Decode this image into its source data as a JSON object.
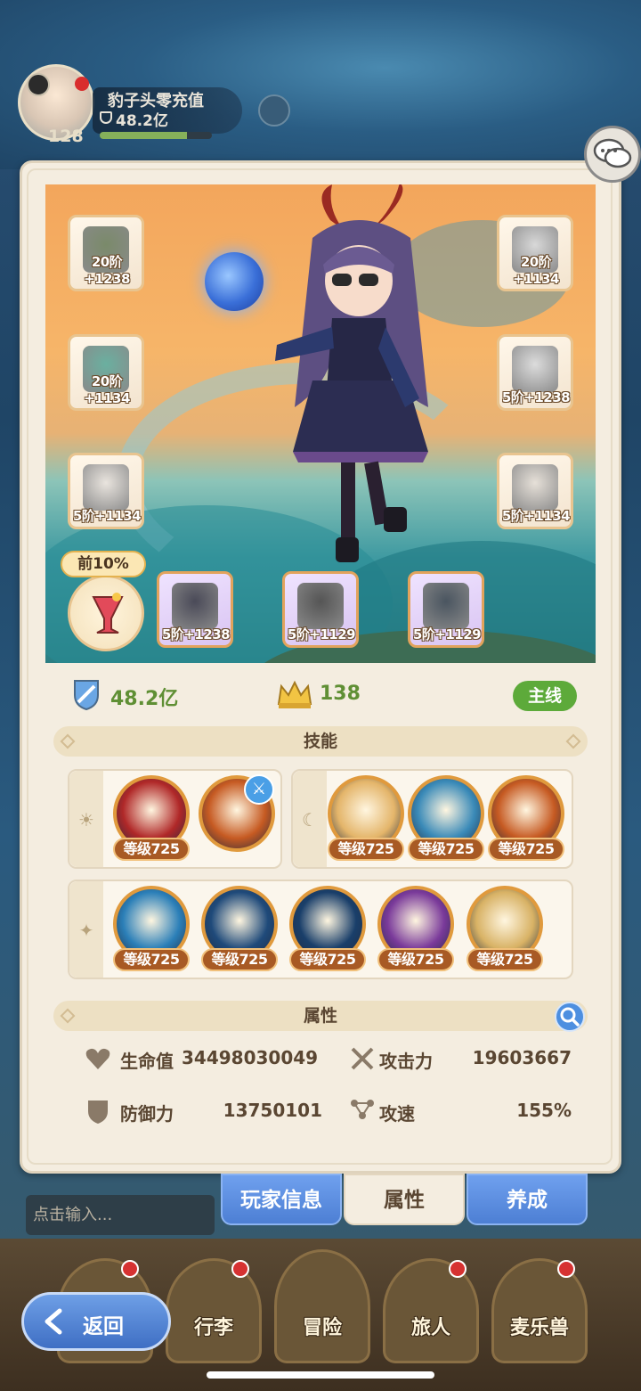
{
  "player": {
    "name": "豹子头零充值",
    "power": "48.2亿",
    "level": "128",
    "exp_fraction": 0.78
  },
  "equipment": {
    "left": [
      {
        "label": "20阶+1238",
        "color": "#7a8a6a"
      },
      {
        "label": "20阶+1134",
        "color": "#6ab0a0"
      },
      {
        "label": "5阶+1134",
        "color": "#e9e4de"
      }
    ],
    "right": [
      {
        "label": "20阶+1134",
        "color": "#d8d8d8"
      },
      {
        "label": "5阶+1238",
        "color": "#dcdcdc"
      },
      {
        "label": "5阶+1134",
        "color": "#e6e0d8"
      }
    ],
    "bottom": [
      {
        "label": "5阶+1238",
        "color": "#4a4a58"
      },
      {
        "label": "5阶+1129",
        "color": "#555"
      },
      {
        "label": "5阶+1129",
        "color": "#4a5560"
      }
    ],
    "potion_tag": "前10%"
  },
  "stats": {
    "power": "48.2亿",
    "level": "138",
    "mode_tag": "主线"
  },
  "skills": {
    "title": "技能",
    "sun_group": [
      {
        "level": "等级725",
        "color": "#b02828",
        "icon": "spider-icon"
      },
      {
        "level": "",
        "color": "#c65a22",
        "icon": "fire-cage-icon"
      }
    ],
    "moon_group": [
      {
        "level": "等级725",
        "color": "#e4b56a",
        "icon": "cloud-swirl-icon"
      },
      {
        "level": "等级725",
        "color": "#3a8ab8",
        "icon": "ice-burst-icon"
      },
      {
        "level": "等级725",
        "color": "#c65a22",
        "icon": "fire-cage-icon"
      }
    ],
    "star_group": [
      {
        "level": "等级725",
        "color": "#2b7fb8",
        "icon": "web-icon"
      },
      {
        "level": "等级725",
        "color": "#1f4a7a",
        "icon": "claw-icon"
      },
      {
        "level": "等级725",
        "color": "#1a3f6a",
        "icon": "shadow-figure-icon"
      },
      {
        "level": "等级725",
        "color": "#7a3a9a",
        "icon": "vortex-icon"
      },
      {
        "level": "等级725",
        "color": "#d8b265",
        "icon": "wind-icon"
      }
    ]
  },
  "attributes": {
    "title": "属性",
    "hp_label": "生命值",
    "hp_value": "34498030049",
    "atk_label": "攻击力",
    "atk_value": "19603667",
    "def_label": "防御力",
    "def_value": "13750101",
    "spd_label": "攻速",
    "spd_value": "155%"
  },
  "tabs": {
    "player_info": "玩家信息",
    "attributes": "属性",
    "nurture": "养成"
  },
  "chat": {
    "placeholder": "点击输入..."
  },
  "nav": {
    "back": "返回",
    "luggage": "行李",
    "adventure": "冒险",
    "traveler": "旅人",
    "pet": "麦乐兽"
  }
}
